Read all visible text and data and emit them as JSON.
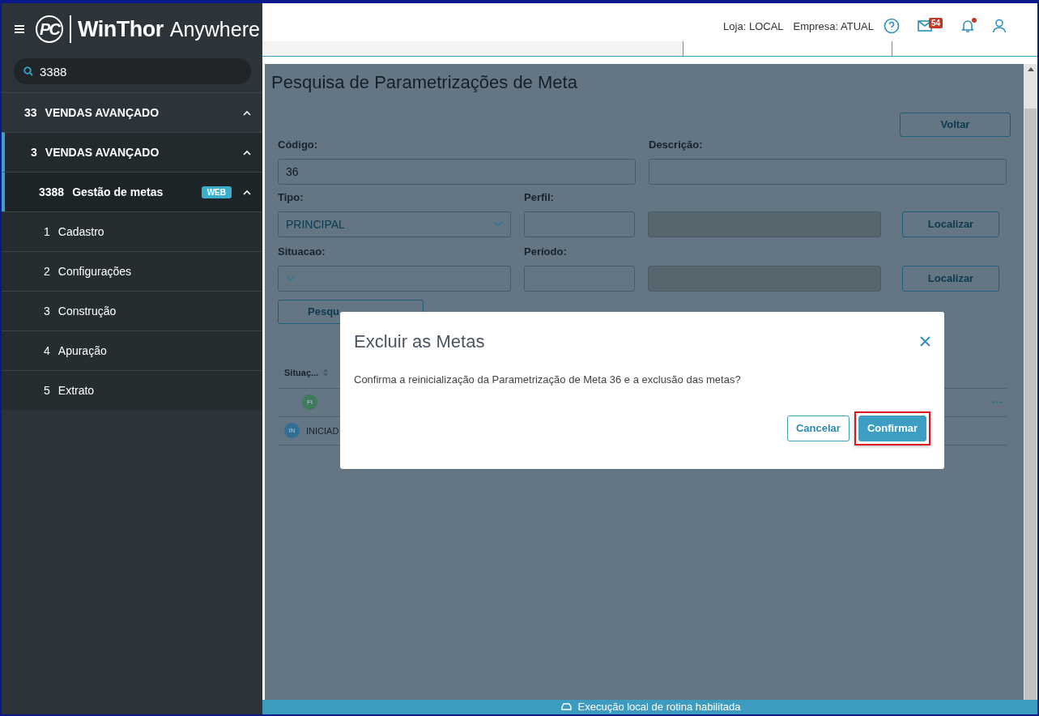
{
  "header": {
    "store": "Loja: LOCAL",
    "company": "Empresa: ATUAL",
    "mail_count": "54",
    "has_notification": true
  },
  "sidebar": {
    "logo_mark": "PC",
    "logo_title": "WinThor",
    "logo_subtitle": "Anywhere",
    "search": {
      "value": "3388"
    },
    "menu": [
      {
        "code": "33",
        "label": "VENDAS AVANÇADO",
        "expanded": true,
        "children": [
          {
            "code": "3",
            "label": "VENDAS AVANÇADO",
            "expanded": true,
            "children": [
              {
                "code": "3388",
                "label": "Gestão de metas",
                "badge": "WEB",
                "expanded": true,
                "children": [
                  {
                    "code": "1",
                    "label": "Cadastro"
                  },
                  {
                    "code": "2",
                    "label": "Configurações"
                  },
                  {
                    "code": "3",
                    "label": "Construção"
                  },
                  {
                    "code": "4",
                    "label": "Apuração"
                  },
                  {
                    "code": "5",
                    "label": "Extrato"
                  }
                ]
              }
            ]
          }
        ]
      }
    ]
  },
  "page": {
    "title": "Pesquisa de Parametrizações de Meta",
    "back_button": "Voltar",
    "codigo": {
      "label": "Código:",
      "value": "36"
    },
    "descricao": {
      "label": "Descrição:"
    },
    "tipo": {
      "label": "Tipo:",
      "value": "PRINCIPAL"
    },
    "perfil": {
      "label": "Perfil:",
      "button": "Localizar"
    },
    "situacao": {
      "label": "Situacao:"
    },
    "periodo": {
      "label": "Período:",
      "button": "Localizar"
    },
    "search_button": "Pesqu",
    "table": {
      "columns": [
        "Situaç..."
      ],
      "rows": [
        {
          "badge": "FI",
          "color": "#3f7a5a"
        },
        {
          "badge": "IN",
          "label": "INICIAD",
          "color": "#2f6f96"
        }
      ]
    }
  },
  "dialog": {
    "title": "Excluir as Metas",
    "message": "Confirma a reinicialização da Parametrização de Meta 36 e a exclusão das metas?",
    "buttons": [
      {
        "label": "Cancelar",
        "kind": "secondary",
        "highlighted": false
      },
      {
        "label": "Confirmar",
        "kind": "primary",
        "highlighted": true
      }
    ]
  },
  "status_bar": {
    "text": "Execução local de rotina habilitada"
  }
}
